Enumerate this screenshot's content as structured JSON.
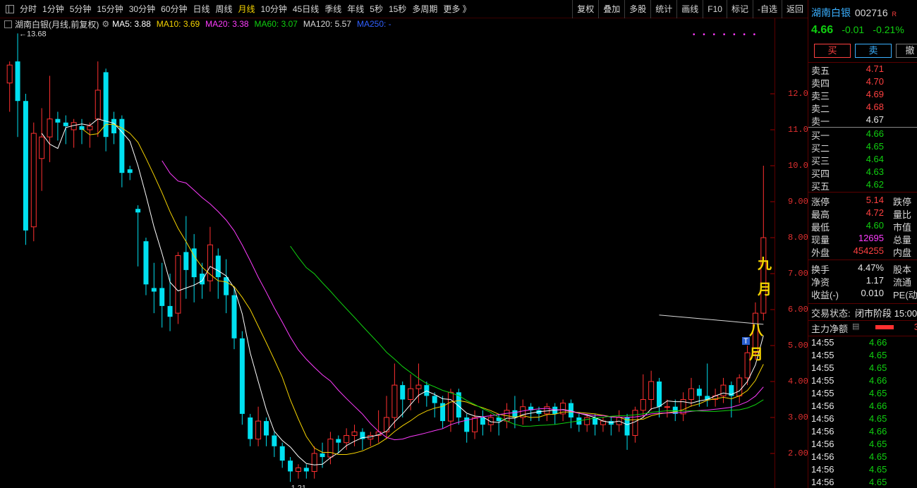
{
  "toolbar": {
    "periods": [
      "分时",
      "1分钟",
      "5分钟",
      "15分钟",
      "30分钟",
      "60分钟",
      "日线",
      "周线",
      "月线",
      "10分钟",
      "45日线",
      "季线",
      "年线",
      "5秒",
      "15秒",
      "多周期",
      "更多 》"
    ],
    "active": "月线",
    "actions": [
      "复权",
      "叠加",
      "多股",
      "统计",
      "画线",
      "F10",
      "标记",
      "-自选",
      "返回"
    ]
  },
  "legend": {
    "name": "湖南白银(月线,前复权)",
    "ma5": "MA5: 3.88",
    "ma10": "MA10: 3.69",
    "ma20": "MA20: 3.38",
    "ma60": "MA60: 3.07",
    "ma120": "MA120: 5.57",
    "ma250": "MA250: -",
    "colors": {
      "ma5": "#ffffff",
      "ma10": "#f5d300",
      "ma20": "#ff3cff",
      "ma60": "#10d010",
      "ma120": "#d8d8d8",
      "ma250": "#3060ff"
    }
  },
  "chart_data": {
    "type": "candlestick",
    "y_ticks": [
      "12.00",
      "11.00",
      "10.00",
      "9.00",
      "8.00",
      "7.00",
      "6.00",
      "5.00",
      "4.00",
      "3.00",
      "2.00"
    ],
    "ylim": [
      1.0,
      13.9
    ],
    "high_label": "13.68",
    "low_label": "1.21",
    "annotations": [
      "八月",
      "九月"
    ],
    "marker": "T",
    "candles": [
      [
        12.3,
        12.8,
        11.6,
        12.9,
        11.5
      ],
      [
        12.9,
        11.8,
        11.0,
        13.68,
        10.8
      ],
      [
        11.8,
        8.2,
        8.0,
        12.0,
        7.8
      ],
      [
        8.3,
        10.9,
        8.1,
        11.2,
        7.9
      ],
      [
        10.2,
        10.8,
        9.8,
        11.6,
        9.3
      ],
      [
        10.8,
        11.3,
        10.6,
        12.5,
        10.1
      ],
      [
        11.3,
        11.2,
        10.9,
        11.5,
        10.7
      ],
      [
        11.2,
        11.1,
        10.7,
        11.4,
        10.6
      ],
      [
        11.0,
        11.2,
        10.8,
        11.3,
        10.5
      ],
      [
        11.1,
        11.0,
        10.8,
        11.3,
        10.6
      ],
      [
        11.0,
        11.1,
        10.7,
        11.2,
        10.5
      ],
      [
        11.3,
        12.1,
        11.1,
        12.9,
        10.8
      ],
      [
        12.6,
        10.8,
        10.6,
        12.7,
        10.4
      ],
      [
        11.3,
        10.9,
        10.7,
        11.5,
        10.6
      ],
      [
        11.3,
        9.8,
        9.6,
        11.4,
        9.4
      ],
      [
        9.9,
        9.8,
        9.7,
        10.0,
        9.6
      ],
      [
        8.8,
        8.7,
        8.4,
        8.9,
        7.2
      ],
      [
        7.9,
        6.7,
        6.5,
        8.0,
        6.4
      ],
      [
        6.6,
        6.5,
        6.3,
        7.3,
        5.9
      ],
      [
        6.6,
        6.1,
        5.9,
        7.3,
        5.5
      ],
      [
        6.1,
        5.8,
        5.6,
        7.0,
        5.4
      ],
      [
        5.9,
        7.5,
        5.7,
        7.6,
        5.6
      ],
      [
        7.6,
        7.1,
        6.9,
        8.6,
        6.3
      ],
      [
        7.7,
        6.9,
        6.7,
        8.1,
        6.2
      ],
      [
        7.0,
        6.7,
        6.5,
        7.3,
        6.3
      ],
      [
        6.8,
        7.8,
        6.6,
        8.3,
        6.5
      ],
      [
        7.5,
        6.9,
        6.7,
        7.7,
        6.3
      ],
      [
        6.9,
        6.4,
        6.1,
        7.4,
        5.9
      ],
      [
        6.4,
        5.2,
        5.0,
        6.6,
        4.9
      ],
      [
        5.2,
        3.1,
        2.9,
        5.4,
        2.8
      ],
      [
        3.0,
        2.4,
        2.3,
        3.1,
        2.2
      ],
      [
        2.4,
        2.9,
        2.3,
        3.3,
        2.2
      ],
      [
        2.9,
        2.5,
        2.3,
        3.0,
        2.2
      ],
      [
        2.5,
        2.2,
        2.0,
        2.6,
        1.9
      ],
      [
        2.2,
        1.8,
        1.7,
        2.3,
        1.6
      ],
      [
        1.8,
        1.5,
        1.3,
        1.9,
        1.21
      ],
      [
        1.5,
        1.6,
        1.4,
        1.7,
        1.3
      ],
      [
        1.6,
        1.5,
        1.3,
        1.7,
        1.3
      ],
      [
        1.5,
        2.0,
        1.4,
        2.2,
        1.3
      ],
      [
        2.0,
        1.9,
        1.7,
        2.3,
        1.6
      ],
      [
        1.9,
        2.4,
        1.8,
        2.6,
        1.7
      ],
      [
        2.4,
        2.3,
        2.1,
        2.5,
        2.0
      ],
      [
        2.3,
        2.5,
        2.2,
        2.7,
        2.1
      ],
      [
        2.5,
        2.6,
        2.3,
        2.8,
        2.2
      ],
      [
        2.6,
        2.4,
        2.2,
        2.7,
        2.1
      ],
      [
        2.4,
        2.5,
        2.3,
        2.6,
        2.2
      ],
      [
        2.5,
        2.6,
        2.4,
        3.2,
        2.3
      ],
      [
        2.6,
        3.0,
        2.5,
        3.6,
        2.4
      ],
      [
        3.0,
        3.9,
        2.9,
        4.5,
        2.7
      ],
      [
        3.9,
        3.5,
        3.2,
        4.0,
        3.0
      ],
      [
        3.5,
        3.8,
        3.4,
        4.2,
        3.2
      ],
      [
        3.8,
        3.9,
        3.6,
        4.5,
        3.4
      ],
      [
        3.9,
        3.6,
        3.5,
        4.0,
        3.3
      ],
      [
        3.6,
        3.4,
        3.2,
        3.7,
        3.0
      ],
      [
        3.4,
        2.9,
        2.8,
        3.6,
        2.7
      ],
      [
        2.9,
        3.7,
        2.8,
        3.8,
        2.6
      ],
      [
        3.7,
        3.0,
        2.9,
        3.8,
        2.8
      ],
      [
        3.0,
        2.6,
        2.4,
        3.1,
        2.3
      ],
      [
        2.6,
        3.0,
        2.5,
        3.2,
        2.4
      ],
      [
        3.0,
        2.8,
        2.6,
        3.2,
        2.5
      ],
      [
        2.8,
        3.0,
        2.7,
        3.1,
        2.6
      ],
      [
        3.0,
        2.9,
        2.7,
        3.1,
        2.5
      ],
      [
        2.9,
        3.2,
        2.8,
        3.4,
        2.7
      ],
      [
        3.2,
        3.0,
        2.8,
        3.6,
        2.7
      ],
      [
        3.0,
        3.3,
        2.9,
        3.5,
        2.8
      ],
      [
        3.3,
        3.2,
        3.0,
        3.4,
        2.9
      ],
      [
        3.2,
        3.1,
        3.0,
        3.3,
        2.9
      ],
      [
        3.1,
        3.3,
        3.0,
        3.4,
        2.9
      ],
      [
        3.3,
        3.1,
        2.9,
        3.4,
        2.8
      ],
      [
        3.1,
        3.4,
        3.0,
        3.5,
        2.9
      ],
      [
        3.4,
        3.0,
        2.8,
        3.5,
        2.7
      ],
      [
        3.0,
        2.8,
        2.7,
        3.1,
        2.6
      ],
      [
        2.8,
        3.0,
        2.7,
        3.1,
        2.6
      ],
      [
        3.0,
        2.8,
        2.6,
        3.1,
        2.5
      ],
      [
        2.8,
        2.9,
        2.7,
        3.0,
        2.6
      ],
      [
        2.9,
        2.8,
        2.6,
        3.0,
        2.5
      ],
      [
        2.8,
        3.0,
        2.7,
        3.2,
        2.6
      ],
      [
        3.0,
        2.5,
        2.3,
        3.1,
        2.1
      ],
      [
        2.5,
        3.2,
        2.4,
        3.3,
        2.3
      ],
      [
        3.2,
        3.5,
        3.1,
        4.2,
        3.0
      ],
      [
        3.5,
        4.0,
        3.4,
        4.3,
        3.2
      ],
      [
        4.0,
        3.3,
        3.2,
        4.1,
        3.0
      ],
      [
        3.3,
        3.3,
        3.1,
        3.5,
        3.0
      ],
      [
        3.3,
        3.1,
        3.0,
        3.5,
        2.9
      ],
      [
        3.1,
        3.5,
        3.0,
        3.7,
        2.9
      ],
      [
        3.5,
        3.8,
        3.4,
        4.1,
        3.3
      ],
      [
        3.8,
        3.6,
        3.4,
        3.9,
        3.3
      ],
      [
        3.6,
        3.5,
        3.4,
        4.5,
        3.3
      ],
      [
        3.5,
        3.6,
        3.4,
        3.8,
        3.3
      ],
      [
        3.6,
        3.9,
        3.5,
        4.1,
        3.4
      ],
      [
        3.9,
        3.6,
        3.4,
        4.0,
        3.0
      ],
      [
        3.6,
        4.1,
        3.5,
        4.2,
        3.4
      ],
      [
        4.1,
        4.8,
        4.0,
        5.0,
        3.9
      ],
      [
        4.8,
        5.9,
        4.7,
        6.2,
        4.6
      ],
      [
        5.9,
        8.0,
        5.8,
        10.0,
        5.7
      ]
    ]
  },
  "panel": {
    "name": "湖南白银",
    "code": "002716",
    "flag": "R",
    "last": "4.66",
    "change": "-0.01",
    "pct": "-0.21%",
    "buy_btn": "买",
    "sell_btn": "卖",
    "cancel_btn": "撤",
    "asks": [
      [
        "卖五",
        "4.71"
      ],
      [
        "卖四",
        "4.70"
      ],
      [
        "卖三",
        "4.69"
      ],
      [
        "卖二",
        "4.68"
      ],
      [
        "卖一",
        "4.67"
      ]
    ],
    "bids": [
      [
        "买一",
        "4.66"
      ],
      [
        "买二",
        "4.65"
      ],
      [
        "买三",
        "4.64"
      ],
      [
        "买四",
        "4.63"
      ],
      [
        "买五",
        "4.62"
      ]
    ],
    "stats": [
      [
        "涨停",
        "5.14",
        "跌停"
      ],
      [
        "最高",
        "4.72",
        "量比"
      ],
      [
        "最低",
        "4.60",
        "市值"
      ],
      [
        "现量",
        "12695",
        "总量"
      ],
      [
        "外盘",
        "454255",
        "内盘"
      ]
    ],
    "stats2": [
      [
        "换手",
        "4.47%",
        "股本"
      ],
      [
        "净资",
        "1.17",
        "流通"
      ],
      [
        "收益(-)",
        "0.010",
        "PE(动"
      ]
    ],
    "status_label": "交易状态:",
    "status_value": "闭市阶段 15:00",
    "flow_label": "主力净额",
    "flow_value": "3",
    "ticks": [
      [
        "14:55",
        "4.66"
      ],
      [
        "14:55",
        "4.65"
      ],
      [
        "14:55",
        "4.65"
      ],
      [
        "14:55",
        "4.66"
      ],
      [
        "14:55",
        "4.65"
      ],
      [
        "14:56",
        "4.66"
      ],
      [
        "14:56",
        "4.65"
      ],
      [
        "14:56",
        "4.66"
      ],
      [
        "14:56",
        "4.65"
      ],
      [
        "14:56",
        "4.65"
      ],
      [
        "14:56",
        "4.65"
      ],
      [
        "14:56",
        "4.65"
      ],
      [
        "14:56",
        "4.65"
      ]
    ]
  }
}
